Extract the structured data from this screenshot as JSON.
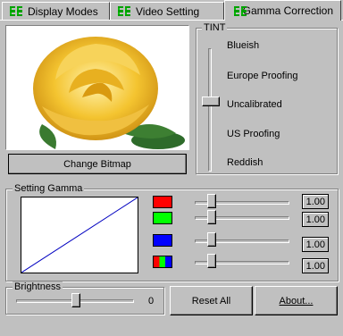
{
  "tabs": [
    {
      "label": "Display Modes",
      "icon": "monitor-settings-icon",
      "active": false
    },
    {
      "label": "Video Setting",
      "icon": "monitor-settings-icon",
      "active": false
    },
    {
      "label": "Gamma Correction",
      "icon": "monitor-settings-icon",
      "active": true
    }
  ],
  "preview": {
    "subject": "yellow rose bitmap"
  },
  "change_bitmap_label": "Change Bitmap",
  "tint": {
    "title": "TINT",
    "options": [
      "Blueish",
      "Europe Proofing",
      "Uncalibrated",
      "US Proofing",
      "Reddish"
    ],
    "selected": "Uncalibrated"
  },
  "gamma": {
    "title": "Setting Gamma",
    "channels": [
      {
        "name": "red",
        "color": "#ff0000",
        "value": "1.00"
      },
      {
        "name": "green",
        "color": "#00ff00",
        "value": "1.00"
      },
      {
        "name": "blue",
        "color": "#0000ff",
        "value": "1.00"
      },
      {
        "name": "all",
        "color": "rgb",
        "value": "1.00"
      }
    ],
    "curve_color": "#0000c0"
  },
  "brightness": {
    "title": "Brightness",
    "value": "0"
  },
  "buttons": {
    "reset_all": "Reset All",
    "about": "About..."
  }
}
